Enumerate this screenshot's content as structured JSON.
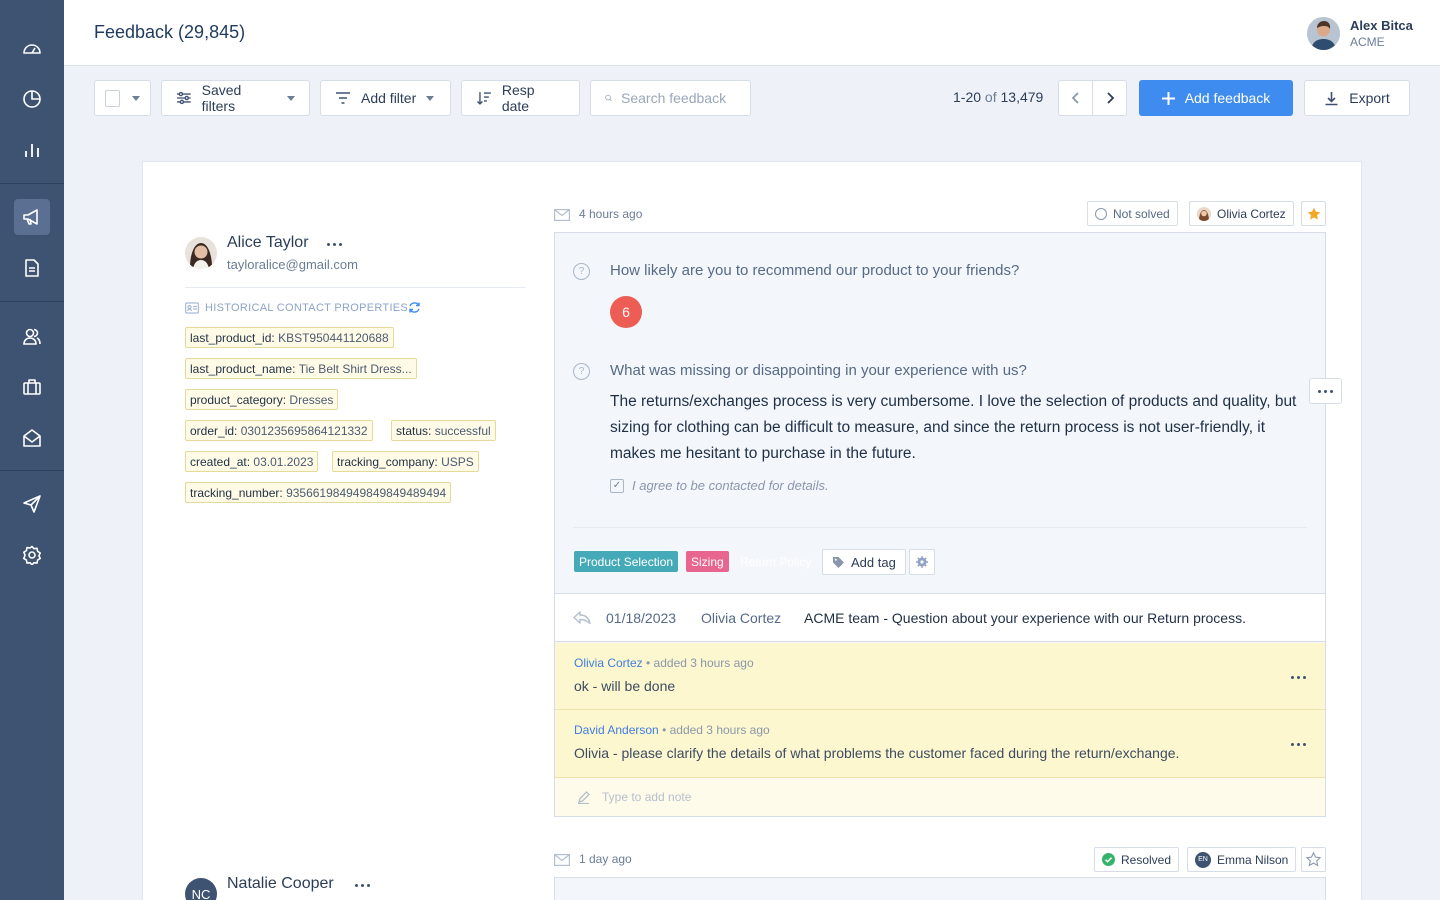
{
  "header": {
    "title": "Feedback (29,845)",
    "user_name": "Alex Bitca",
    "user_org": "ACME"
  },
  "sidebar": {
    "items": [
      {
        "icon": "dashboard-icon"
      },
      {
        "icon": "pie-chart-icon"
      },
      {
        "icon": "bar-chart-icon"
      },
      {
        "icon": "megaphone-icon",
        "active": true
      },
      {
        "icon": "document-icon"
      },
      {
        "icon": "contacts-icon"
      },
      {
        "icon": "briefcase-icon"
      },
      {
        "icon": "mail-icon"
      },
      {
        "icon": "send-icon"
      },
      {
        "icon": "settings-icon"
      }
    ]
  },
  "toolbar": {
    "saved_filters": "Saved filters",
    "add_filter": "Add filter",
    "sort": "Resp date",
    "search_placeholder": "Search feedback",
    "pager_range": "1-20",
    "pager_of": "of",
    "pager_total": "13,479",
    "add_feedback": "Add feedback",
    "export": "Export"
  },
  "feedback_1": {
    "contact": {
      "name": "Alice Taylor",
      "email": "tayloralice@gmail.com"
    },
    "historical_label": "HISTORICAL CONTACT PROPERTIES",
    "properties": [
      {
        "key": "last_product_id:",
        "value": "KBST950441120688"
      },
      {
        "key": "last_product_name:",
        "value": "Tie Belt Shirt Dress..."
      },
      {
        "key": "product_category:",
        "value": "Dresses"
      },
      {
        "key": "order_id:",
        "value": "0301235695864121332"
      },
      {
        "key": "status:",
        "value": "successful"
      },
      {
        "key": "created_at:",
        "value": "03.01.2023"
      },
      {
        "key": "tracking_company:",
        "value": "USPS"
      },
      {
        "key": "tracking_number:",
        "value": "93566198494984984948949​4"
      }
    ],
    "time": "4 hours ago",
    "status": "Not solved",
    "assignee": "Olivia Cortez",
    "starred": true,
    "questions": [
      {
        "text": "How likely are you to recommend our product to your friends?",
        "score": "6"
      },
      {
        "text": "What was missing or disappointing in your experience with us?",
        "answer": "The returns/exchanges process is very cumbersome. I love the selection of products and quality, but sizing for clothing can be difficult to measure, and since the return process is not user-friendly, it makes me hesitant to purchase in the future."
      }
    ],
    "consent": "I agree to be contacted for details.",
    "tags": [
      {
        "label": "Product Selection",
        "color": "#45aab8"
      },
      {
        "label": "Sizing",
        "color": "#f0a830"
      },
      {
        "label": "Return Policy",
        "color": "#e8658f"
      }
    ],
    "add_tag": "Add tag",
    "reply": {
      "date": "01/18/2023",
      "author": "Olivia Cortez",
      "subject": "ACME team - Question about your experience with our Return process."
    },
    "notes": [
      {
        "author": "Olivia Cortez",
        "meta": " • added 3 hours ago",
        "body": "ok - will be done"
      },
      {
        "author": "David Anderson",
        "meta": " • added 3 hours ago",
        "body": "Olivia - please clarify the details of what problems the customer faced during the return/exchange."
      }
    ],
    "note_placeholder": "Type to add note"
  },
  "feedback_2": {
    "contact": {
      "initials": "NC",
      "name": "Natalie Cooper"
    },
    "time": "1 day ago",
    "status": "Resolved",
    "assignee_initials": "EN",
    "assignee": "Emma Nilson",
    "starred": false
  },
  "colors": {
    "sidebar": "#3e5272",
    "accent": "#3f8cf0",
    "score": "#ee5d54",
    "resolved": "#34b36b",
    "star": "#f5a623"
  }
}
